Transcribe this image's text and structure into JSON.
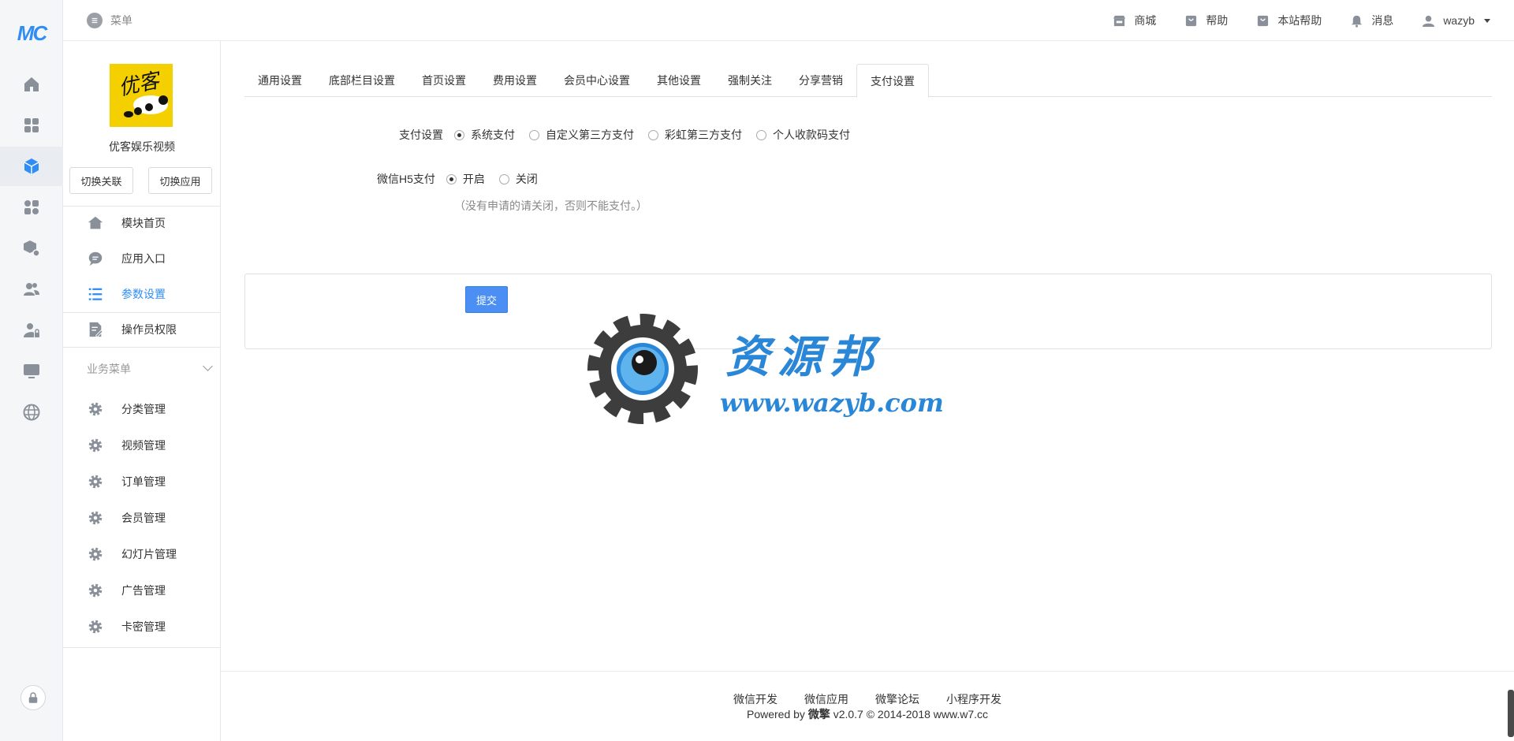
{
  "rail": {
    "logo": "MC",
    "icons": [
      "home-icon",
      "grid-icon",
      "cube-icon",
      "apps-icon",
      "box-settings-icon",
      "users-icon",
      "user-lock-icon",
      "monitor-icon",
      "globe-icon",
      "lock-icon"
    ],
    "active_index": 2
  },
  "topbar": {
    "menu_label": "菜单",
    "links": [
      {
        "icon": "store-icon",
        "label": "商城"
      },
      {
        "icon": "help-icon",
        "label": "帮助"
      },
      {
        "icon": "site-help-icon",
        "label": "本站帮助"
      },
      {
        "icon": "bell-icon",
        "label": "消息"
      }
    ],
    "user": "wazyb"
  },
  "module": {
    "name": "优客娱乐视频",
    "logo_text": "优客",
    "switch_link": "切换关联",
    "switch_app": "切换应用",
    "nav": [
      {
        "icon": "home-icon",
        "label": "模块首页"
      },
      {
        "icon": "chat-icon",
        "label": "应用入口"
      },
      {
        "icon": "list-icon",
        "label": "参数设置"
      },
      {
        "icon": "edit-doc-icon",
        "label": "操作员权限"
      }
    ],
    "active_nav": 2,
    "biz_header": "业务菜单",
    "biz": [
      {
        "icon": "gear-icon",
        "label": "分类管理"
      },
      {
        "icon": "gear-icon",
        "label": "视频管理"
      },
      {
        "icon": "gear-icon",
        "label": "订单管理"
      },
      {
        "icon": "gear-icon",
        "label": "会员管理"
      },
      {
        "icon": "gear-icon",
        "label": "幻灯片管理"
      },
      {
        "icon": "gear-icon",
        "label": "广告管理"
      },
      {
        "icon": "gear-icon",
        "label": "卡密管理"
      }
    ]
  },
  "tabs": [
    "通用设置",
    "底部栏目设置",
    "首页设置",
    "费用设置",
    "会员中心设置",
    "其他设置",
    "强制关注",
    "分享营销",
    "支付设置"
  ],
  "active_tab": 8,
  "form": {
    "pay_label": "支付设置",
    "pay_options": [
      "系统支付",
      "自定义第三方支付",
      "彩虹第三方支付",
      "个人收款码支付"
    ],
    "pay_selected": 0,
    "h5_label": "微信H5支付",
    "h5_options": [
      "开启",
      "关闭"
    ],
    "h5_selected": 0,
    "h5_hint": "（没有申请的请关闭，否则不能支付。）",
    "submit": "提交"
  },
  "footer": {
    "links": [
      "微信开发",
      "微信应用",
      "微擎论坛",
      "小程序开发"
    ],
    "powered_prefix": "Powered by",
    "powered_brand": "微擎",
    "powered_suffix": "v2.0.7 © 2014-2018 www.w7.cc"
  },
  "watermark": {
    "cn": "资源邦",
    "url": "www.wazyb.com"
  }
}
